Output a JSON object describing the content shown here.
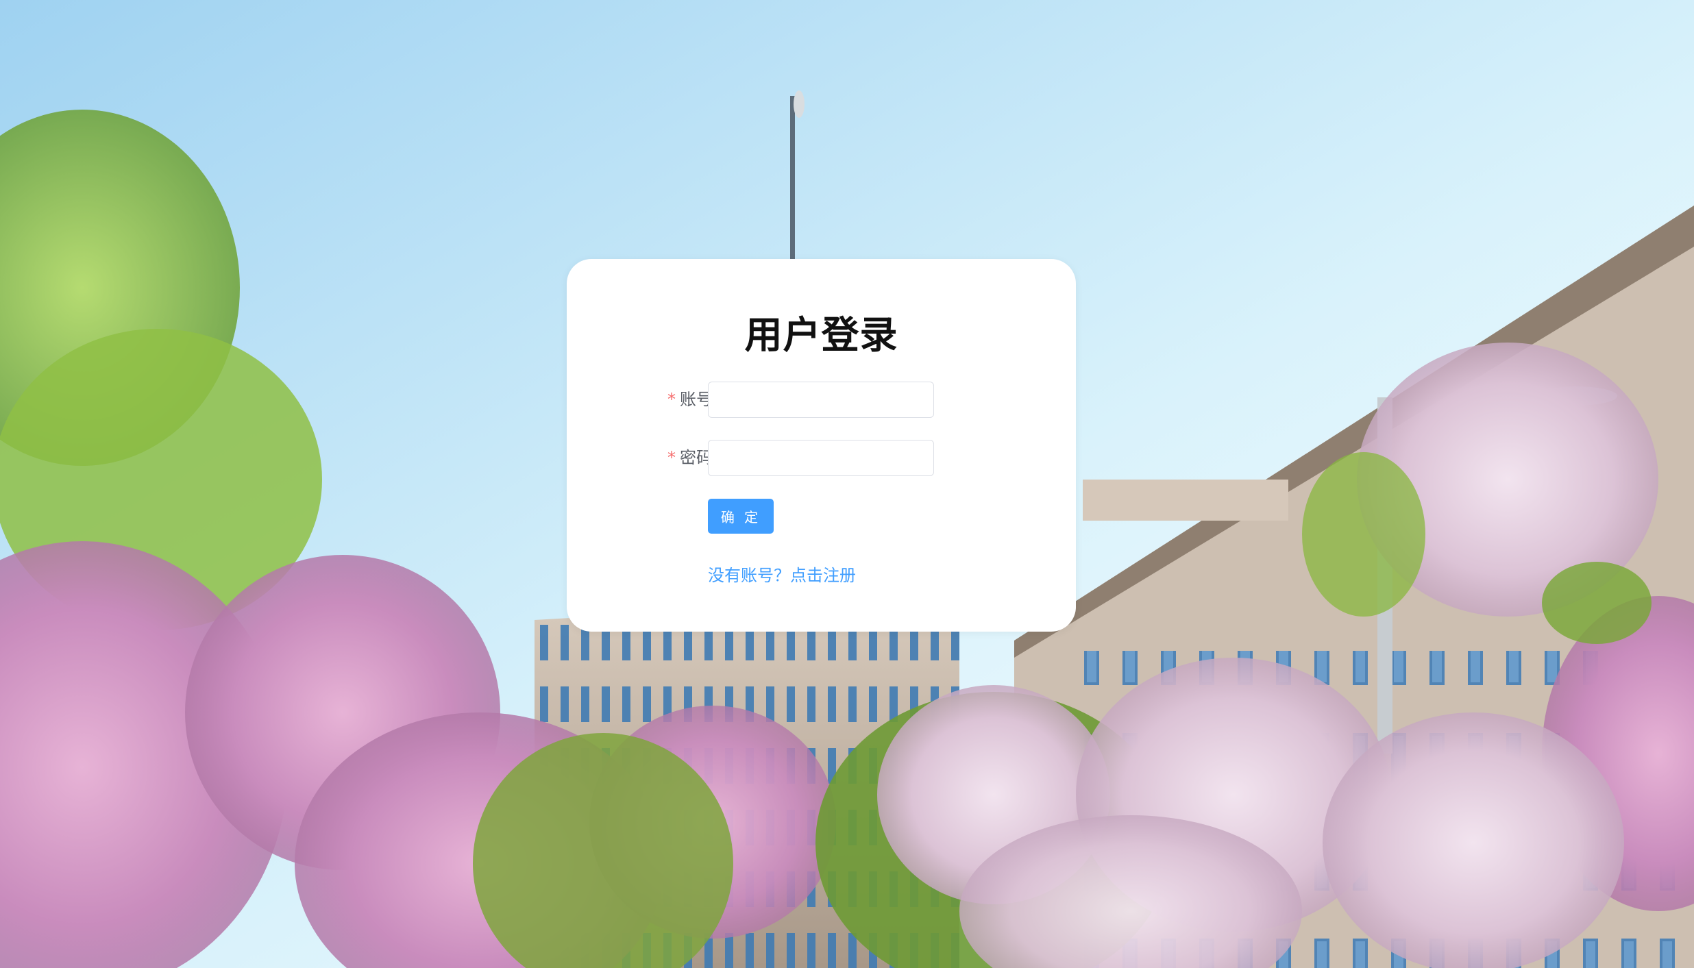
{
  "login": {
    "title": "用户登录",
    "account_label": "账号",
    "password_label": "密码",
    "required_mark": "*",
    "account_value": "",
    "password_value": "",
    "submit_label": "确 定",
    "register_link": "没有账号？点击注册"
  },
  "colors": {
    "primary": "#409eff",
    "required": "#f56c6c",
    "card": "#ffffff"
  }
}
